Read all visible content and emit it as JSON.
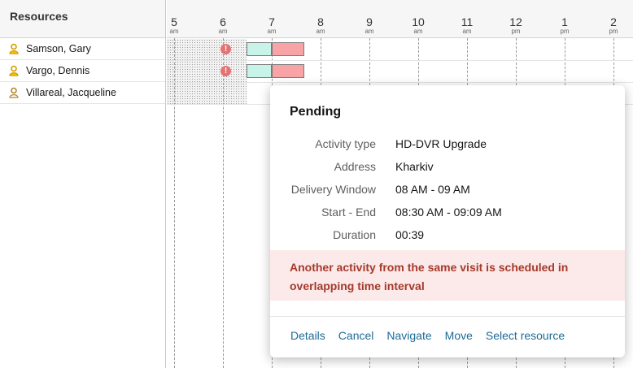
{
  "resources": {
    "header": "Resources",
    "items": [
      {
        "name": "Samson, Gary"
      },
      {
        "name": "Vargo, Dennis"
      },
      {
        "name": "Villareal, Jacqueline"
      }
    ]
  },
  "timeline": {
    "ticks": [
      {
        "hour": "5",
        "ampm": "am"
      },
      {
        "hour": "6",
        "ampm": "am"
      },
      {
        "hour": "7",
        "ampm": "am"
      },
      {
        "hour": "8",
        "ampm": "am"
      },
      {
        "hour": "9",
        "ampm": "am"
      },
      {
        "hour": "10",
        "ampm": "am"
      },
      {
        "hour": "11",
        "ampm": "am"
      },
      {
        "hour": "12",
        "ampm": "pm"
      },
      {
        "hour": "1",
        "ampm": "pm"
      },
      {
        "hour": "2",
        "ampm": "pm"
      }
    ],
    "warning_symbol": "!"
  },
  "popup": {
    "title": "Pending",
    "fields": [
      {
        "label": "Activity type",
        "value": "HD-DVR Upgrade"
      },
      {
        "label": "Address",
        "value": "Kharkiv"
      },
      {
        "label": "Delivery Window",
        "value": "08 AM - 09 AM"
      },
      {
        "label": "Start - End",
        "value": "08:30 AM - 09:09 AM"
      },
      {
        "label": "Duration",
        "value": "00:39"
      }
    ],
    "alert_line1": "Another activity from the same visit is scheduled in",
    "alert_line2": "overlapping time interval",
    "actions": {
      "details": "Details",
      "cancel": "Cancel",
      "navigate": "Navigate",
      "move": "Move",
      "select_resource": "Select resource"
    }
  },
  "colors": {
    "pending": "#f8a3a6",
    "travel": "#c8f3e8",
    "alert_bg": "#fce9e9",
    "alert_text": "#a53a2c",
    "link": "#1c6b96",
    "warning": "#e57373"
  },
  "icons": {
    "resource": "user-icon",
    "warning": "warning-icon"
  }
}
